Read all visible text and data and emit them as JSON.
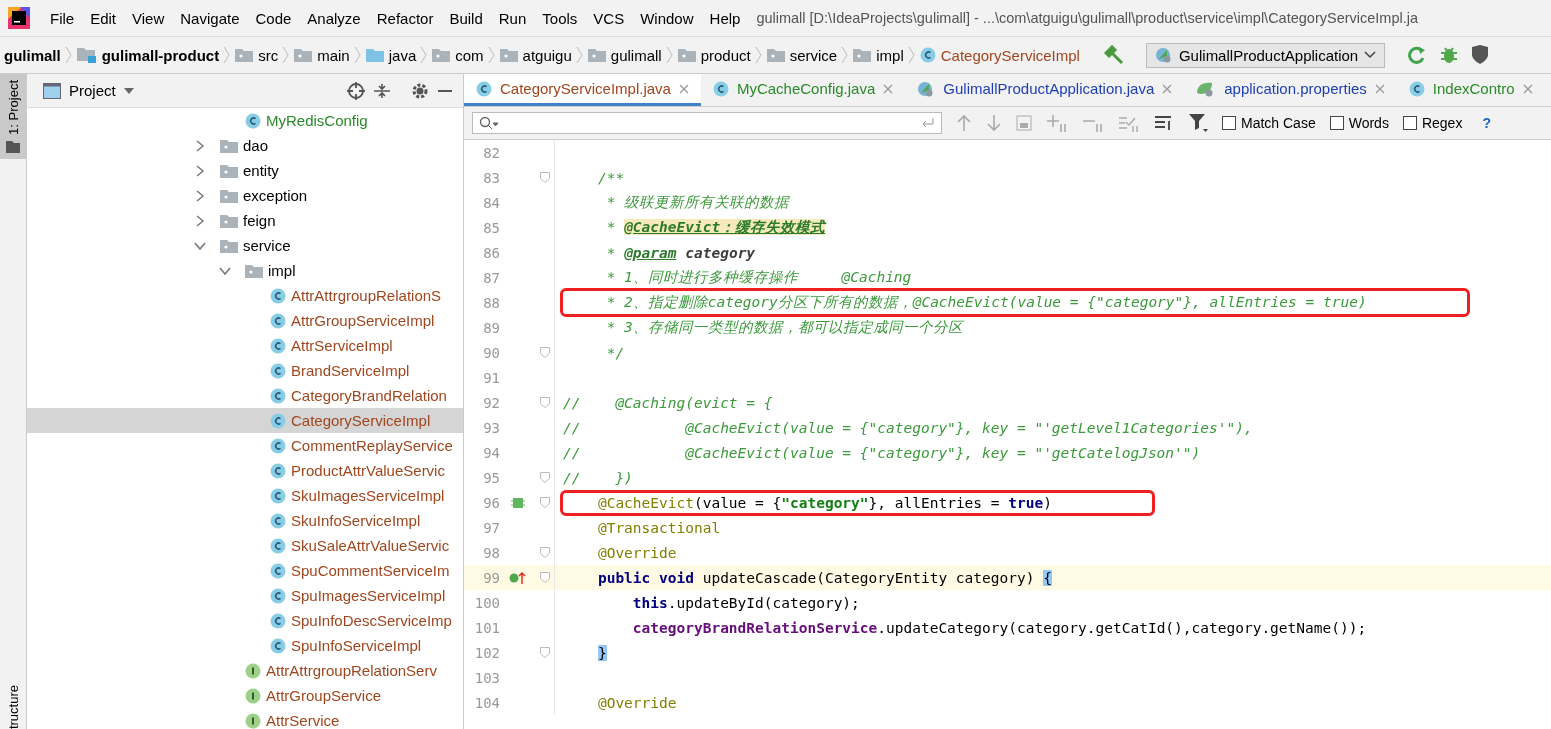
{
  "window": {
    "title": "gulimall [D:\\IdeaProjects\\gulimall] - ...\\com\\atguigu\\gulimall\\product\\service\\impl\\CategoryServiceImpl.ja"
  },
  "menu": [
    "File",
    "Edit",
    "View",
    "Navigate",
    "Code",
    "Analyze",
    "Refactor",
    "Build",
    "Run",
    "Tools",
    "VCS",
    "Window",
    "Help"
  ],
  "breadcrumbs": [
    {
      "label": "gulimall",
      "kind": "project"
    },
    {
      "label": "gulimall-product",
      "kind": "module"
    },
    {
      "label": "src",
      "kind": "folder"
    },
    {
      "label": "main",
      "kind": "folder"
    },
    {
      "label": "java",
      "kind": "source"
    },
    {
      "label": "com",
      "kind": "package"
    },
    {
      "label": "atguigu",
      "kind": "package"
    },
    {
      "label": "gulimall",
      "kind": "package"
    },
    {
      "label": "product",
      "kind": "package"
    },
    {
      "label": "service",
      "kind": "package"
    },
    {
      "label": "impl",
      "kind": "package"
    },
    {
      "label": "CategoryServiceImpl",
      "kind": "class",
      "color": "#a0461e"
    }
  ],
  "run_config": {
    "label": "GulimallProductApplication"
  },
  "side_strip": {
    "top": "1: Project",
    "bottom": "tructure"
  },
  "project_panel": {
    "title": "Project",
    "tree": [
      {
        "children": [
          {
            "label": "MyRedisConfig",
            "kind": "class",
            "color": "#2a8a2a",
            "selected": false
          }
        ]
      },
      {
        "label": "dao",
        "kind": "package",
        "expanded": false
      },
      {
        "label": "entity",
        "kind": "package",
        "expanded": false
      },
      {
        "label": "exception",
        "kind": "package",
        "expanded": false
      },
      {
        "label": "feign",
        "kind": "package",
        "expanded": false
      },
      {
        "label": "service",
        "kind": "package",
        "expanded": true,
        "children": [
          {
            "label": "impl",
            "kind": "package",
            "expanded": true,
            "children": [
              {
                "label": "AttrAttrgroupRelationS",
                "kind": "class",
                "color": "#a0461e",
                "selected": false
              },
              {
                "label": "AttrGroupServiceImpl",
                "kind": "class",
                "color": "#a0461e",
                "selected": false
              },
              {
                "label": "AttrServiceImpl",
                "kind": "class",
                "color": "#a0461e",
                "selected": false
              },
              {
                "label": "BrandServiceImpl",
                "kind": "class",
                "color": "#a0461e",
                "selected": false
              },
              {
                "label": "CategoryBrandRelation",
                "kind": "class",
                "color": "#a0461e",
                "selected": false
              },
              {
                "label": "CategoryServiceImpl",
                "kind": "class",
                "color": "#a0461e",
                "selected": true
              },
              {
                "label": "CommentReplayService",
                "kind": "class",
                "color": "#a0461e",
                "selected": false
              },
              {
                "label": "ProductAttrValueServic",
                "kind": "class",
                "color": "#a0461e",
                "selected": false
              },
              {
                "label": "SkuImagesServiceImpl",
                "kind": "class",
                "color": "#a0461e",
                "selected": false
              },
              {
                "label": "SkuInfoServiceImpl",
                "kind": "class",
                "color": "#a0461e",
                "selected": false
              },
              {
                "label": "SkuSaleAttrValueServic",
                "kind": "class",
                "color": "#a0461e",
                "selected": false
              },
              {
                "label": "SpuCommentServiceIm",
                "kind": "class",
                "color": "#a0461e",
                "selected": false
              },
              {
                "label": "SpuImagesServiceImpl",
                "kind": "class",
                "color": "#a0461e",
                "selected": false
              },
              {
                "label": "SpuInfoDescServiceImp",
                "kind": "class",
                "color": "#a0461e",
                "selected": false
              },
              {
                "label": "SpuInfoServiceImpl",
                "kind": "class",
                "color": "#a0461e",
                "selected": false
              }
            ]
          },
          {
            "label": "AttrAttrgroupRelationServ",
            "kind": "interface",
            "color": "#a0461e",
            "selected": false
          },
          {
            "label": "AttrGroupService",
            "kind": "interface",
            "color": "#a0461e",
            "selected": false
          },
          {
            "label": "AttrService",
            "kind": "interface",
            "color": "#a0461e",
            "selected": false
          }
        ]
      }
    ]
  },
  "editor_tabs": [
    {
      "label": "CategoryServiceImpl.java",
      "kind": "class",
      "color": "#a0461e",
      "selected": true
    },
    {
      "label": "MyCacheConfig.java",
      "kind": "class",
      "color": "#2a8a2a",
      "selected": false
    },
    {
      "label": "GulimallProductApplication.java",
      "kind": "spring",
      "color": "#1e3fb4",
      "selected": false
    },
    {
      "label": "application.properties",
      "kind": "properties",
      "color": "#1e3fb4",
      "selected": false
    },
    {
      "label": "IndexContro",
      "kind": "class",
      "color": "#2a8a2a",
      "selected": false
    }
  ],
  "find_bar": {
    "options": [
      {
        "label": "Match Case",
        "checked": false
      },
      {
        "label": "Words",
        "checked": false
      },
      {
        "label": "Regex",
        "checked": false
      }
    ],
    "help": "?"
  },
  "code": {
    "lines": [
      {
        "number": "82"
      },
      {
        "number": "83",
        "fold": true,
        "segments": [
          {
            "kind": "comment",
            "text": "    /**"
          }
        ]
      },
      {
        "number": "84",
        "segments": [
          {
            "kind": "comment",
            "text": "     * 级联更新所有关联的数据"
          }
        ]
      },
      {
        "number": "85",
        "segments": [
          {
            "kind": "comment",
            "text": "     * "
          },
          {
            "kind": "doc-highlight",
            "text": "@CacheEvict：缓存失效模式"
          }
        ]
      },
      {
        "number": "86",
        "segments": [
          {
            "kind": "comment",
            "text": "     * "
          },
          {
            "kind": "doc-tag",
            "text": "@param"
          },
          {
            "kind": "doc-param",
            "text": " category"
          }
        ]
      },
      {
        "number": "87",
        "segments": [
          {
            "kind": "comment",
            "text": "     * 1、同时进行多种缓存操作     @Caching"
          }
        ]
      },
      {
        "number": "88",
        "boxed": true,
        "segments": [
          {
            "kind": "comment",
            "text": "     * 2、指定删除category分区下所有的数据，@CacheEvict(value = {\"category\"}, allEntries = true)"
          }
        ]
      },
      {
        "number": "89",
        "segments": [
          {
            "kind": "comment",
            "text": "     * 3、存储同一类型的数据，都可以指定成同一个分区"
          }
        ]
      },
      {
        "number": "90",
        "fold": true,
        "segments": [
          {
            "kind": "comment",
            "text": "     */"
          }
        ]
      },
      {
        "number": "91"
      },
      {
        "number": "92",
        "fold": true,
        "segments": [
          {
            "kind": "comment",
            "text": "//    @Caching(evict = {"
          }
        ]
      },
      {
        "number": "93",
        "segments": [
          {
            "kind": "comment",
            "text": "//            @CacheEvict(value = {\"category\"}, key = \"'getLevel1Categories'\"),"
          }
        ]
      },
      {
        "number": "94",
        "segments": [
          {
            "kind": "comment",
            "text": "//            @CacheEvict(value = {\"category\"}, key = \"'getCatelogJson'\")"
          }
        ]
      },
      {
        "number": "95",
        "fold": true,
        "segments": [
          {
            "kind": "comment",
            "text": "//    })"
          }
        ]
      },
      {
        "number": "96",
        "fold": true,
        "gutter": {
          "kind": "bean"
        },
        "boxed": true,
        "segments": [
          {
            "kind": "annotation",
            "text": "    @CacheEvict"
          },
          {
            "kind": "plain",
            "text": "(value = {"
          },
          {
            "kind": "string",
            "text": "\"category\""
          },
          {
            "kind": "plain",
            "text": "}, allEntries = "
          },
          {
            "kind": "keyword",
            "text": "true"
          },
          {
            "kind": "plain",
            "text": ")"
          }
        ]
      },
      {
        "number": "97",
        "segments": [
          {
            "kind": "annotation",
            "text": "    @Transactional"
          }
        ]
      },
      {
        "number": "98",
        "fold": true,
        "segments": [
          {
            "kind": "annotation",
            "text": "    @Override"
          }
        ]
      },
      {
        "number": "99",
        "fold": true,
        "current": true,
        "gutter": {
          "kind": "override"
        },
        "segments": [
          {
            "kind": "keyword",
            "text": "    public void"
          },
          {
            "kind": "plain",
            "text": " updateCascade(CategoryEntity category) "
          },
          {
            "kind": "brace-match",
            "text": "{"
          }
        ]
      },
      {
        "number": "100",
        "segments": [
          {
            "kind": "keyword",
            "text": "        this"
          },
          {
            "kind": "plain",
            "text": ".updateById(category);"
          }
        ]
      },
      {
        "number": "101",
        "segments": [
          {
            "kind": "field",
            "text": "        categoryBrandRelationService"
          },
          {
            "kind": "plain",
            "text": ".updateCategory(category.getCatId(),category.getName());"
          }
        ]
      },
      {
        "number": "102",
        "fold": true,
        "segments": [
          {
            "kind": "brace-match",
            "text": "    }"
          }
        ]
      },
      {
        "number": "103"
      },
      {
        "number": "104",
        "segments": [
          {
            "kind": "annotation",
            "text": "    @Override"
          }
        ]
      }
    ]
  }
}
